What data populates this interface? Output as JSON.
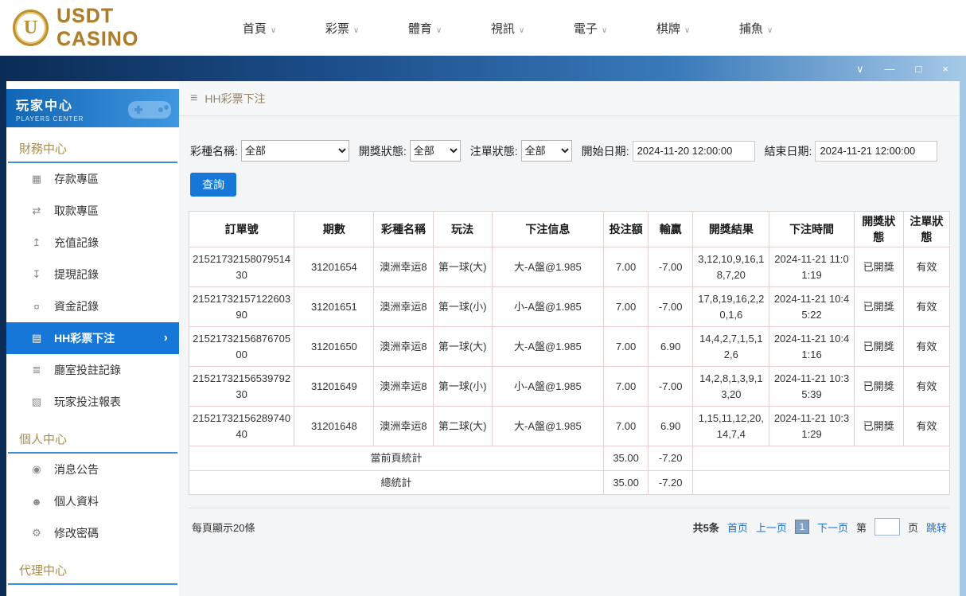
{
  "top_nav": {
    "brand": "USDT CASINO",
    "logo_letter": "U",
    "items": [
      {
        "id": "home",
        "label": "首頁"
      },
      {
        "id": "lottery",
        "label": "彩票"
      },
      {
        "id": "sports",
        "label": "體育"
      },
      {
        "id": "video",
        "label": "視訊"
      },
      {
        "id": "electronic",
        "label": "電子"
      },
      {
        "id": "chess",
        "label": "棋牌"
      },
      {
        "id": "fishing",
        "label": "捕魚"
      }
    ]
  },
  "icons": {
    "menu": "≡",
    "chevron_down": "∨",
    "chevron_right": "›",
    "window_controls": [
      {
        "id": "collapse",
        "glyph": "∨"
      },
      {
        "id": "minimize",
        "glyph": "—"
      },
      {
        "id": "maximize",
        "glyph": "□"
      },
      {
        "id": "close",
        "glyph": "×"
      }
    ]
  },
  "sidebar": {
    "title": "玩家中心",
    "subtitle": "PLAYERS CENTER",
    "sections": [
      {
        "id": "finance-center",
        "label": "財務中心",
        "items": [
          {
            "id": "deposit-zone",
            "label": "存款專區",
            "glyph": "▦",
            "active": false
          },
          {
            "id": "withdraw-zone",
            "label": "取款專區",
            "glyph": "⇄",
            "active": false
          },
          {
            "id": "recharge-record",
            "label": "充值記錄",
            "glyph": "↥",
            "active": false
          },
          {
            "id": "withdraw-record",
            "label": "提現記錄",
            "glyph": "↧",
            "active": false
          },
          {
            "id": "funds-record",
            "label": "資金記錄",
            "glyph": "¤",
            "active": false
          },
          {
            "id": "hh-lottery-bets",
            "label": "HH彩票下注",
            "glyph": "▤",
            "active": true
          },
          {
            "id": "room-bet-record",
            "label": "廳室投註記錄",
            "glyph": "≣",
            "active": false
          },
          {
            "id": "player-bet-report",
            "label": "玩家投注報表",
            "glyph": "▧",
            "active": false
          }
        ]
      },
      {
        "id": "personal-center",
        "label": "個人中心",
        "items": [
          {
            "id": "notice",
            "label": "消息公告",
            "glyph": "◉",
            "active": false
          },
          {
            "id": "profile",
            "label": "個人資料",
            "glyph": "☻",
            "active": false
          },
          {
            "id": "change-password",
            "label": "修改密碼",
            "glyph": "⚙",
            "active": false
          }
        ]
      },
      {
        "id": "agent-center",
        "label": "代理中心",
        "items": []
      }
    ]
  },
  "breadcrumb": {
    "title": "HH彩票下注"
  },
  "filters": {
    "lottery_label": "彩種名稱:",
    "lottery_value": "全部",
    "draw_status_label": "開獎狀態:",
    "draw_status_value": "全部",
    "order_status_label": "注單狀態:",
    "order_status_value": "全部",
    "start_label": "開始日期:",
    "start_value": "2024-11-20 12:00:00",
    "end_label": "結束日期:",
    "end_value": "2024-11-21 12:00:00",
    "search_button": "查詢"
  },
  "table": {
    "headers": [
      "訂單號",
      "期數",
      "彩種名稱",
      "玩法",
      "下注信息",
      "投注額",
      "輸贏",
      "開獎結果",
      "下注時間",
      "開獎狀態",
      "注單狀態"
    ],
    "rows": [
      [
        "2152173215807951430",
        "31201654",
        "澳洲幸运8",
        "第一球(大)",
        "大-A盤@1.985",
        "7.00",
        "-7.00",
        "3,12,10,9,16,18,7,20",
        "2024-11-21 11:01:19",
        "已開獎",
        "有效"
      ],
      [
        "2152173215712260390",
        "31201651",
        "澳洲幸运8",
        "第一球(小)",
        "小-A盤@1.985",
        "7.00",
        "-7.00",
        "17,8,19,16,2,20,1,6",
        "2024-11-21 10:45:22",
        "已開獎",
        "有效"
      ],
      [
        "2152173215687670500",
        "31201650",
        "澳洲幸运8",
        "第一球(大)",
        "大-A盤@1.985",
        "7.00",
        "6.90",
        "14,4,2,7,1,5,12,6",
        "2024-11-21 10:41:16",
        "已開獎",
        "有效"
      ],
      [
        "2152173215653979230",
        "31201649",
        "澳洲幸运8",
        "第一球(小)",
        "小-A盤@1.985",
        "7.00",
        "-7.00",
        "14,2,8,1,3,9,13,20",
        "2024-11-21 10:35:39",
        "已開獎",
        "有效"
      ],
      [
        "2152173215628974040",
        "31201648",
        "澳洲幸运8",
        "第二球(大)",
        "大-A盤@1.985",
        "7.00",
        "6.90",
        "1,15,11,12,20,14,7,4",
        "2024-11-21 10:31:29",
        "已開獎",
        "有效"
      ]
    ],
    "page_summary": {
      "label": "當前頁統計",
      "bet": "35.00",
      "winloss": "-7.20"
    },
    "total_summary": {
      "label": "總統計",
      "bet": "35.00",
      "winloss": "-7.20"
    }
  },
  "pagination": {
    "page_size_text": "每頁顯示20條",
    "total_text": "共5条",
    "first": "首页",
    "prev": "上一页",
    "current": "1",
    "next": "下一页",
    "jump_prefix": "第",
    "jump_value": "",
    "jump_suffix": "页",
    "jump_button": "跳转"
  }
}
